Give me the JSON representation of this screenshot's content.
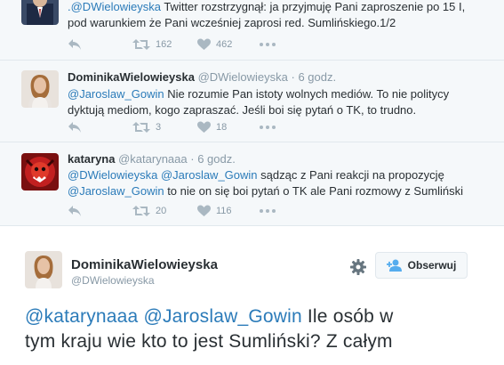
{
  "tweets": [
    {
      "reply_to": ".@DWielowieyska",
      "text": " Twitter rozstrzygnął: ja przyjmuję Pani zaproszenie po 15 I, pod warunkiem że Pani wcześniej zaprosi red. Sumlińskiego.1/2",
      "retweets": "162",
      "likes": "462"
    },
    {
      "name": "DominikaWielowieyska",
      "handle": "@DWielowieyska",
      "time": "· 6 godz.",
      "mention": "@Jaroslaw_Gowin",
      "text": " Nie rozumie Pan istoty wolnych mediów. To nie politycy dyktują mediom, kogo zapraszać. Jeśli boi się pytań o TK, to trudno.",
      "retweets": "3",
      "likes": "18"
    },
    {
      "name": "kataryna",
      "handle": "@katarynaaa",
      "time": "· 6 godz.",
      "mention1": "@DWielowieyska",
      "mention2": "@Jaroslaw_Gowin",
      "text1": " sądząc z Pani reakcji na propozycję",
      "mention3": "@Jaroslaw_Gowin",
      "text2": " to nie on się boi pytań o TK ale Pani rozmowy z Sumliński",
      "retweets": "20",
      "likes": "116"
    }
  ],
  "main_tweet": {
    "name": "DominikaWielowieyska",
    "handle": "@DWielowieyska",
    "follow_label": "Obserwuj",
    "mention1": "@katarynaaa",
    "mention2": "@Jaroslaw_Gowin",
    "text_line1_rest": " Ile osób w",
    "text_line2": "tym kraju wie kto to jest Sumliński? Z całym"
  },
  "icons": [
    "reply-icon",
    "retweet-icon",
    "like-icon",
    "more-icon",
    "gear-icon",
    "follow-user-icon"
  ],
  "colors": {
    "link": "#2b7bb9",
    "muted": "#8899a6",
    "text": "#292f33",
    "bg_tweet": "#f5f8fa"
  }
}
